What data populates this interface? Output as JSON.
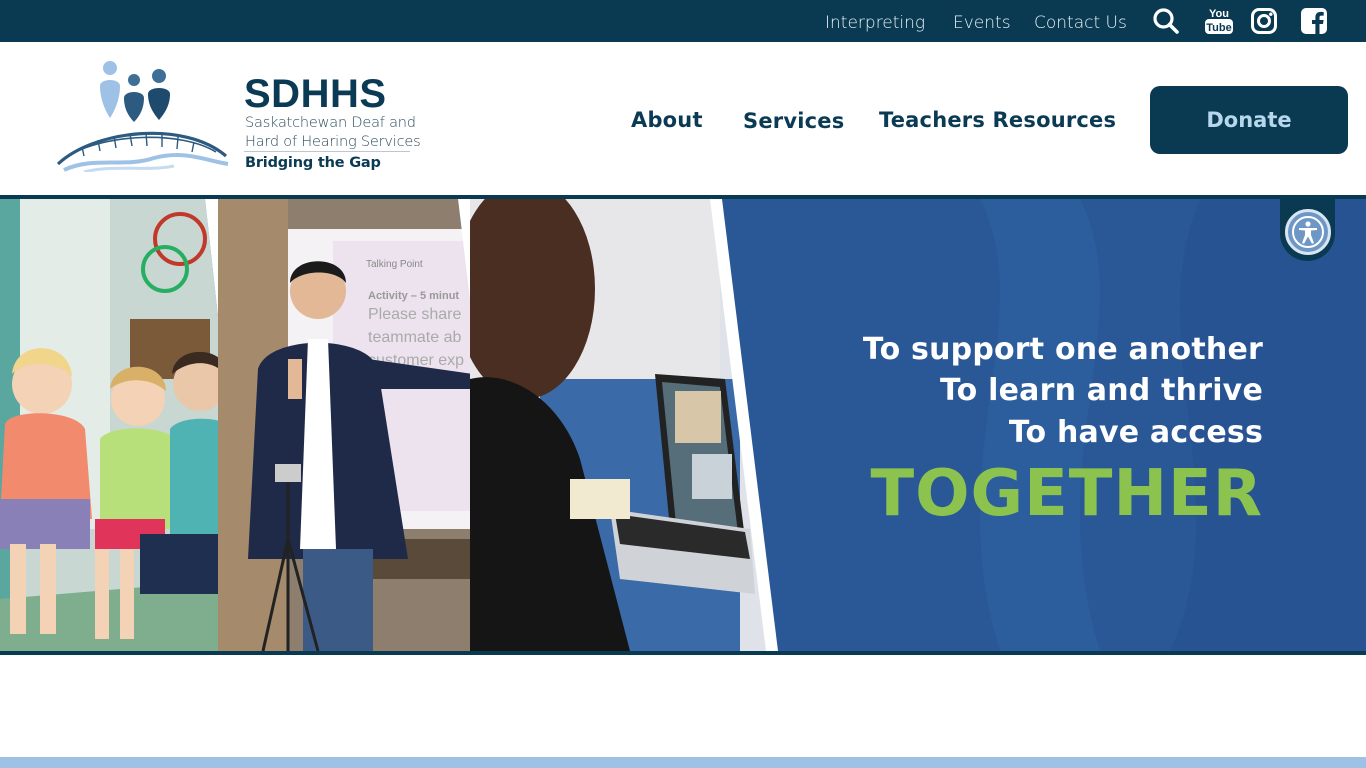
{
  "topbar": {
    "links": [
      "Interpreting",
      "Events",
      "Contact Us"
    ],
    "icons": [
      "search-icon",
      "youtube-icon",
      "instagram-icon",
      "facebook-icon"
    ],
    "youtube_you": "You",
    "youtube_tube": "Tube"
  },
  "logo": {
    "title": "SDHHS",
    "subtitle_line1": "Saskatchewan Deaf and",
    "subtitle_line2": "Hard of Hearing Services",
    "tagline": "Bridging the Gap"
  },
  "nav": {
    "items": [
      "About",
      "Services",
      "Teachers Resources"
    ],
    "donate_label": "Donate"
  },
  "hero": {
    "line1": "To support one another",
    "line2": "To learn and thrive",
    "line3": "To have access",
    "emphasis": "TOGETHER",
    "slide_text": {
      "heading": "Talking Point",
      "line1": "Activity – 5 minut",
      "line2": "Please share",
      "line3": "teammate ab",
      "line4": "customer exp"
    }
  },
  "colors": {
    "topbar": "#0a3a52",
    "brand_navy": "#0b3b54",
    "hero_blue": "#2a5897",
    "accent_green": "#8cc34f",
    "donate_text": "#b7d8ec",
    "bottom_band": "#9ec1e6"
  }
}
